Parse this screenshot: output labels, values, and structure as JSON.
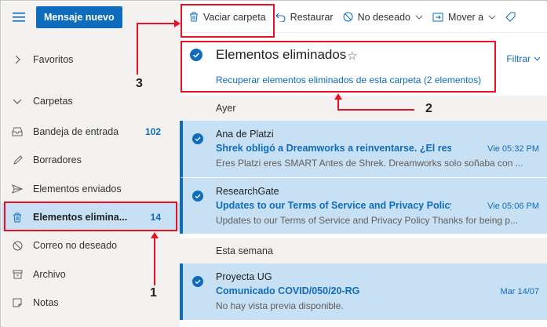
{
  "toolbar": {
    "new_message": "Mensaje nuevo",
    "empty_folder": "Vaciar carpeta",
    "restore": "Restaurar",
    "junk": "No deseado",
    "move_to": "Mover a"
  },
  "sidebar": {
    "favorites": "Favoritos",
    "folders": "Carpetas",
    "items": [
      {
        "label": "Bandeja de entrada",
        "count": "102",
        "icon": "inbox-icon"
      },
      {
        "label": "Borradores",
        "count": "",
        "icon": "pencil-icon"
      },
      {
        "label": "Elementos enviados",
        "count": "",
        "icon": "send-icon"
      },
      {
        "label": "Elementos elimina...",
        "count": "14",
        "icon": "trash-icon",
        "selected": true
      },
      {
        "label": "Correo no deseado",
        "count": "",
        "icon": "block-icon"
      },
      {
        "label": "Archivo",
        "count": "",
        "icon": "archive-icon"
      },
      {
        "label": "Notas",
        "count": "",
        "icon": "note-icon"
      }
    ]
  },
  "folder": {
    "title": "Elementos eliminados",
    "recover_link": "Recuperar elementos eliminados de esta carpeta (2 elementos)",
    "filter": "Filtrar"
  },
  "groups": {
    "yesterday": "Ayer",
    "this_week": "Esta semana"
  },
  "messages": [
    {
      "sender": "Ana de Platzi",
      "subject": "Shrek obligó a Dreamworks a reinventarse. ¿El result...",
      "date": "Vie 05:32 PM",
      "preview": "Eres Platzi eres SMART Antes de Shrek. Dreamworks solo soñaba con ..."
    },
    {
      "sender": "ResearchGate",
      "subject": "Updates to our Terms of Service and Privacy Policy",
      "date": "Vie 05:06 PM",
      "preview": "Updates to our Terms of Service and Privacy Policy Thanks for being p..."
    },
    {
      "sender": "Proyecta UG",
      "subject": "Comunicado COVID/050/20-RG",
      "date": "Mar 14/07",
      "preview": "No hay vista previa disponible."
    }
  ],
  "annotations": {
    "one": "1",
    "two": "2",
    "three": "3"
  },
  "colors": {
    "accent": "#0f6cbd",
    "selection": "#c7e0f4",
    "annotation": "#e81123"
  }
}
